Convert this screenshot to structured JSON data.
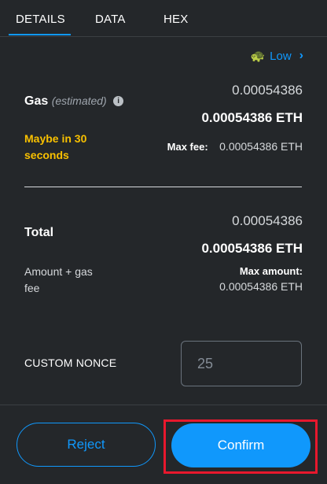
{
  "tabs": [
    {
      "label": "DETAILS",
      "active": true
    },
    {
      "label": "DATA",
      "active": false
    },
    {
      "label": "HEX",
      "active": false
    }
  ],
  "gas_speed": {
    "icon": "turtle-icon",
    "label": "Low"
  },
  "gas": {
    "label": "Gas",
    "qualifier": "(estimated)",
    "amount_secondary": "0.00054386",
    "amount_primary": "0.00054386 ETH",
    "timing": "Maybe in 30 seconds",
    "max_fee_label": "Max fee:",
    "max_fee_value": "0.00054386 ETH"
  },
  "total": {
    "label": "Total",
    "amount_secondary": "0.00054386",
    "amount_primary": "0.00054386 ETH",
    "subtitle": "Amount + gas fee",
    "max_amount_label": "Max amount:",
    "max_amount_value": "0.00054386 ETH"
  },
  "nonce": {
    "label": "CUSTOM NONCE",
    "placeholder": "25"
  },
  "actions": {
    "reject_label": "Reject",
    "confirm_label": "Confirm"
  },
  "colors": {
    "accent": "#1098fc",
    "warning": "#f8c000",
    "background": "#24272a",
    "highlight": "#e8182d"
  }
}
